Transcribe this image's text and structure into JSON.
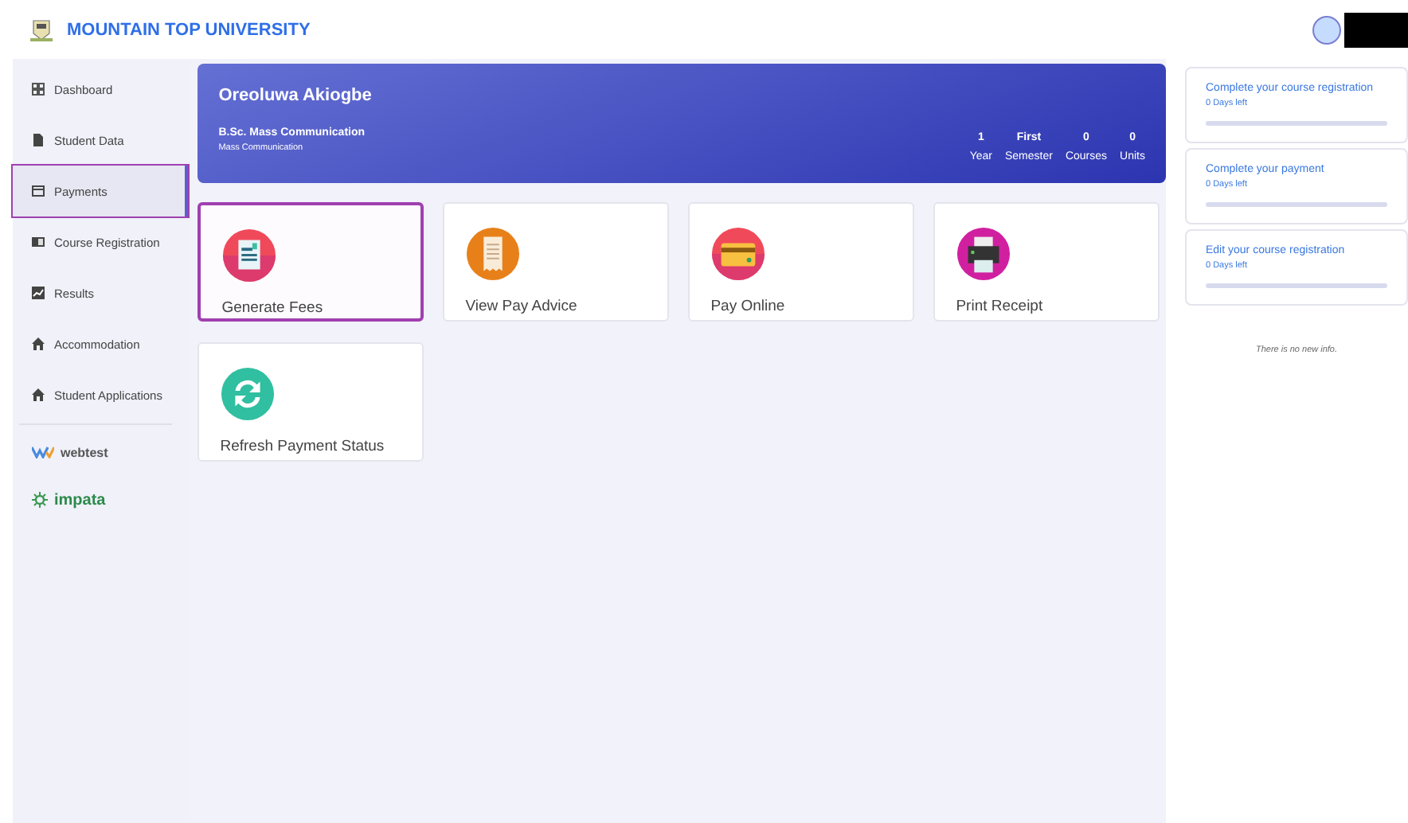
{
  "header": {
    "title": "MOUNTAIN TOP UNIVERSITY"
  },
  "sidebar": {
    "items": [
      {
        "label": "Dashboard",
        "kind": "grid",
        "selected": false,
        "highlighted": false
      },
      {
        "label": "Student Data",
        "kind": "doc",
        "selected": false,
        "highlighted": false
      },
      {
        "label": "Payments",
        "kind": "card",
        "selected": true,
        "highlighted": true
      },
      {
        "label": "Course Registration",
        "kind": "book",
        "selected": false,
        "highlighted": false
      },
      {
        "label": "Results",
        "kind": "chart",
        "selected": false,
        "highlighted": false
      },
      {
        "label": "Accommodation",
        "kind": "home",
        "selected": false,
        "highlighted": false
      },
      {
        "label": "Student Applications",
        "kind": "home",
        "selected": false,
        "highlighted": false
      }
    ],
    "partners": [
      {
        "label": "webtest",
        "kind": "webtest"
      },
      {
        "label": "impata",
        "kind": "impata"
      }
    ]
  },
  "profile": {
    "name": "Oreoluwa Akiogbe",
    "programme": "B.Sc. Mass Communication",
    "department": "Mass Communication",
    "stats": [
      {
        "value": "1",
        "label": "Year"
      },
      {
        "value": "First",
        "label": "Semester"
      },
      {
        "value": "0",
        "label": "Courses"
      },
      {
        "value": "0",
        "label": "Units"
      }
    ]
  },
  "actions": [
    {
      "label": "Generate Fees",
      "kind": "fees",
      "highlighted": true
    },
    {
      "label": "View Pay Advice",
      "kind": "receipt",
      "highlighted": false
    },
    {
      "label": "Pay Online",
      "kind": "card",
      "highlighted": false
    },
    {
      "label": "Print Receipt",
      "kind": "printer",
      "highlighted": false
    },
    {
      "label": "Refresh Payment Status",
      "kind": "refresh",
      "highlighted": false
    }
  ],
  "notices": [
    {
      "title": "Complete your course registration",
      "due": "0 Days left"
    },
    {
      "title": "Complete your payment",
      "due": "0 Days left"
    },
    {
      "title": "Edit your course registration",
      "due": "0 Days left"
    }
  ],
  "info_message": "There is no new info."
}
